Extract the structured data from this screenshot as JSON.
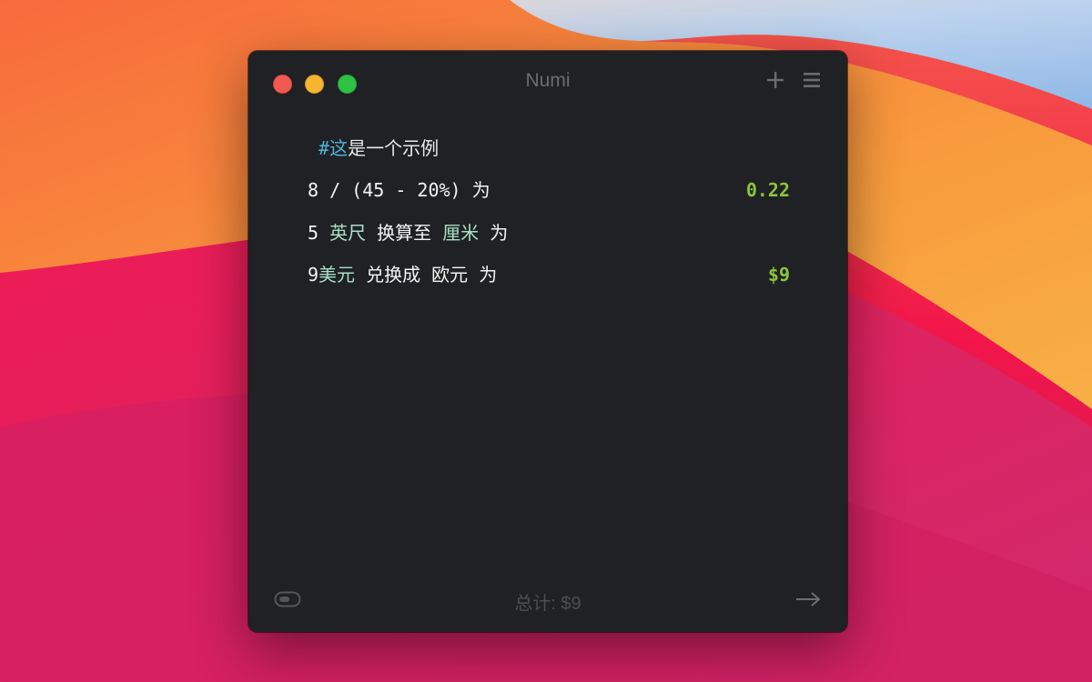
{
  "window": {
    "title": "Numi"
  },
  "toolbar": {
    "add_icon": "plus-icon",
    "menu_icon": "hamburger-menu-icon"
  },
  "editor": {
    "lines": [
      {
        "comment_hash": "#",
        "comment_first": "这",
        "comment_rest": "是一个示例",
        "result": ""
      },
      {
        "expression": "8 / (45 - 20%) 为",
        "result": "0.22"
      },
      {
        "num": "5",
        "unit_from": "英尺",
        "keyword": "换算至",
        "unit_to": "厘米",
        "tail": "为",
        "result": ""
      },
      {
        "num": "9",
        "unit_from": "美元",
        "keyword": "兑换成",
        "unit_to": "欧元",
        "tail": "为",
        "result": "$9"
      }
    ]
  },
  "footer": {
    "total": "总计: $9",
    "toggle_icon": "toggle-icon",
    "arrow_icon": "arrow-right-icon"
  },
  "colors": {
    "background": "#202124",
    "result": "#8bc43d",
    "comment": "#4fb3d9",
    "unit": "#a7e0c7",
    "title": "#6b6c70"
  }
}
